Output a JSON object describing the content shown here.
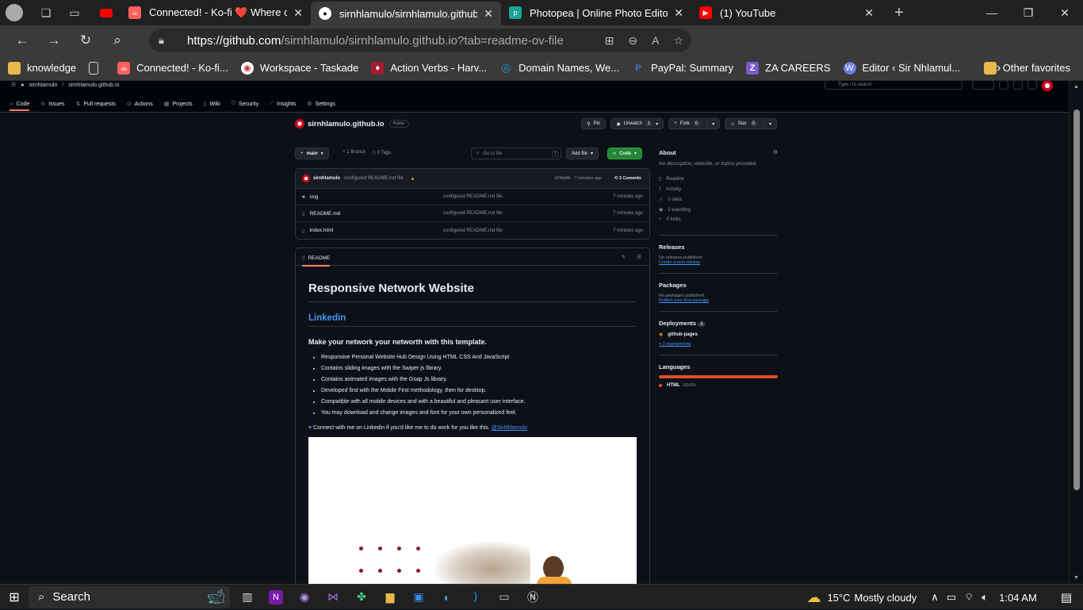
{
  "browser": {
    "tabs": [
      {
        "title": "Connected! - Ko-fi ❤️ Where cre",
        "icon_color": "#ff5e5b"
      },
      {
        "title": "sirnhlamulo/sirnhlamulo.github.i",
        "icon_color": "#ffffff",
        "active": true
      },
      {
        "title": "Photopea | Online Photo Editor",
        "icon_color": "#18a497"
      },
      {
        "title": "(1) YouTube",
        "icon_color": "#ff0000"
      }
    ],
    "url_host": "https://github.com",
    "url_path": "/sirnhlamulo/sirnhlamulo.github.io?tab=readme-ov-file",
    "favorites": [
      {
        "label": "knowledge",
        "icon": "folder-icon"
      },
      {
        "label": "",
        "icon": "page-icon"
      },
      {
        "label": "Connected! - Ko-fi...",
        "icon": "kofi-icon"
      },
      {
        "label": "Workspace - Taskade",
        "icon": "taskade-icon"
      },
      {
        "label": "Action Verbs - Harv...",
        "icon": "harvard-icon"
      },
      {
        "label": "Domain Names, We...",
        "icon": "domain-icon"
      },
      {
        "label": "PayPal: Summary",
        "icon": "paypal-icon"
      },
      {
        "label": "ZA CAREERS",
        "icon": "z-icon"
      },
      {
        "label": "Editor ‹ Sir Nhlamul...",
        "icon": "wordpress-icon"
      }
    ],
    "other_favorites": "Other favorites"
  },
  "github": {
    "breadcrumb_owner": "sirnhlamulo",
    "breadcrumb_repo": "sirnhlamulo.github.io",
    "search_placeholder": "Type / to search",
    "nav": [
      "Code",
      "Issues",
      "Pull requests",
      "Actions",
      "Projects",
      "Wiki",
      "Security",
      "Insights",
      "Settings"
    ],
    "repo_name": "sirnhlamulo.github.io",
    "visibility": "Public",
    "pin": "Pin",
    "unwatch": "Unwatch",
    "unwatch_count": "1",
    "fork": "Fork",
    "fork_count": "0",
    "star": "Star",
    "star_count": "0",
    "branch": "main",
    "branches": "1 Branch",
    "tags": "0 Tags",
    "goto_file": "Go to file",
    "goto_key": "t",
    "add_file": "Add file",
    "code_btn": "Code",
    "commit_author": "sirnhlamulo",
    "commit_msg": "configured README.md file",
    "commit_hash": "d74bbfb · 7 minutes ago",
    "commits": "3 Commits",
    "files": [
      {
        "name": "img",
        "type": "folder",
        "msg": "configured README.md file",
        "time": "7 minutes ago"
      },
      {
        "name": "README.md",
        "type": "file",
        "msg": "configured README.md file",
        "time": "7 minutes ago"
      },
      {
        "name": "index.html",
        "type": "file",
        "msg": "configured README.md file",
        "time": "7 minutes ago"
      }
    ],
    "readme_tab": "README",
    "readme": {
      "h1": "Responsive Network Website",
      "h2": "Linkedin",
      "h3": "Make your network your networth with this template.",
      "bullets": [
        "Responsive Personal Website Hub Design Using HTML CSS And JavaScript",
        "Contains sliding images with the Swiper js library.",
        "Contains animated images with the Gsap Js library.",
        "Developed first with the Mobile First methodology, then for desktop.",
        "Compatible with all mobile devices and with a beautiful and pleasant user interface.",
        "You may download and change images and font for your own personalized feel."
      ],
      "connect_text": "Connect with me on Linkedin if you'd like me to do work for you like this.",
      "connect_link": "@SirNhlamulo"
    },
    "about": {
      "title": "About",
      "desc": "No description, website, or topics provided.",
      "items": [
        {
          "icon": "book-icon",
          "label": "Readme"
        },
        {
          "icon": "pulse-icon",
          "label": "Activity"
        },
        {
          "icon": "star-icon",
          "label": "0 stars"
        },
        {
          "icon": "eye-icon",
          "label": "1 watching"
        },
        {
          "icon": "fork-icon",
          "label": "0 forks"
        }
      ]
    },
    "releases": {
      "title": "Releases",
      "none": "No releases published",
      "link": "Create a new release"
    },
    "packages": {
      "title": "Packages",
      "none": "No packages published",
      "link": "Publish your first package"
    },
    "deployments": {
      "title": "Deployments",
      "count": "3",
      "item": "github-pages",
      "more": "+ 2 deployments"
    },
    "languages": {
      "title": "Languages",
      "name": "HTML",
      "pct": "100.0%",
      "fraction": 1.0,
      "color": "#e34c26"
    }
  },
  "taskbar": {
    "search": "Search",
    "weather": "15°C",
    "weather_desc": "Mostly cloudy",
    "time": "1:04 AM"
  }
}
